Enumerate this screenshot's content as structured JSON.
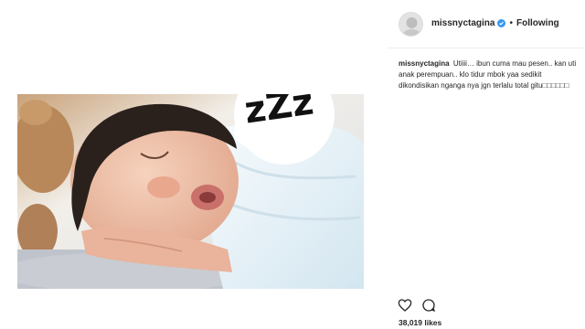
{
  "post": {
    "image_alt_icon": "sleeping-baby-photo",
    "zzz_text": "zZz"
  },
  "header": {
    "username": "missnyctagina",
    "separator": "•",
    "follow_state": "Following"
  },
  "caption": {
    "username": "missnyctagina",
    "text": "Utiiii… ibun cuma mau pesen.. kan uti anak perempuan.. klo tidur mbok yaa sedikit dikondisikan nganga nya jgn terlalu total gitu□□□□□□"
  },
  "actions": {
    "like_icon": "heart-icon",
    "comment_icon": "comment-icon"
  },
  "likes": {
    "count_text": "38,019 likes"
  },
  "colors": {
    "verified_badge": "#3897f0",
    "text": "#262626",
    "divider": "#efefef"
  }
}
